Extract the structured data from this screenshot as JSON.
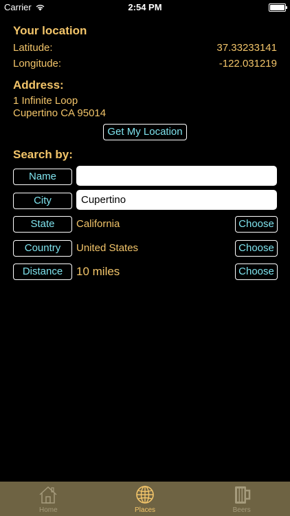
{
  "status_bar": {
    "carrier": "Carrier",
    "time": "2:54 PM"
  },
  "location": {
    "heading": "Your location",
    "latitude_label": "Latitude:",
    "latitude_value": "37.33233141",
    "longitude_label": "Longitude:",
    "longitude_value": "-122.031219"
  },
  "address": {
    "heading": "Address:",
    "line1": "1 Infinite Loop",
    "line2": "Cupertino CA 95014"
  },
  "get_location_button": "Get My Location",
  "search": {
    "heading": "Search by:",
    "name": {
      "label": "Name",
      "value": ""
    },
    "city": {
      "label": "City",
      "value": "Cupertino"
    },
    "state": {
      "label": "State",
      "value": "California",
      "choose": "Choose"
    },
    "country": {
      "label": "Country",
      "value": "United States",
      "choose": "Choose"
    },
    "distance": {
      "label": "Distance",
      "value": "10 miles",
      "choose": "Choose"
    }
  },
  "tabs": [
    {
      "label": "Home",
      "icon": "home-icon",
      "active": false
    },
    {
      "label": "Places",
      "icon": "globe-icon",
      "active": true
    },
    {
      "label": "Beers",
      "icon": "beer-mug-icon",
      "active": false
    }
  ],
  "colors": {
    "background": "#000000",
    "accent_gold": "#f3c56a",
    "button_text_cyan": "#7fe3ee",
    "tab_bar": "#6e6343"
  }
}
